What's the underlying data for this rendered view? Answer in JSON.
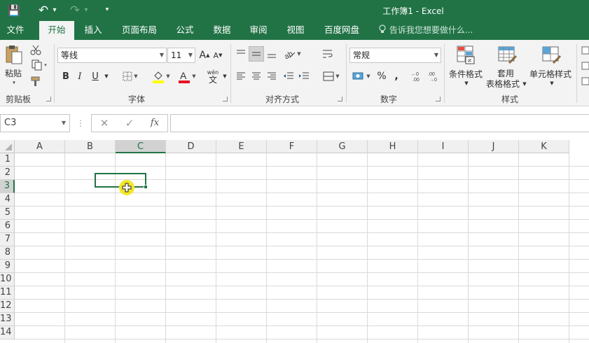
{
  "window": {
    "title": "工作簿1 - Excel"
  },
  "quick_access": {
    "save": "💾",
    "undo": "↶",
    "undo_arrow": "▾",
    "redo": "↷",
    "redo_arrow": "▾",
    "customize": "⯆"
  },
  "tabs": [
    "文件",
    "开始",
    "插入",
    "页面布局",
    "公式",
    "数据",
    "审阅",
    "视图",
    "百度网盘"
  ],
  "tell_me": "告诉我您想要做什么...",
  "ribbon": {
    "clipboard": {
      "paste": "粘贴",
      "group": "剪贴板"
    },
    "font": {
      "name": "等线",
      "size": "11",
      "grow": "A",
      "shrink": "A",
      "bold": "B",
      "italic": "I",
      "underline": "U",
      "wen": "wén",
      "wen_char": "文",
      "group": "字体"
    },
    "alignment": {
      "group": "对齐方式"
    },
    "number": {
      "format": "常规",
      "percent": "%",
      "comma": ",",
      "group": "数字"
    },
    "styles": {
      "conditional": "条件格式",
      "table_1": "套用",
      "table_2": "表格格式",
      "cell": "单元格样式",
      "group": "样式"
    }
  },
  "formula_bar": {
    "name_box": "C3",
    "cancel": "✕",
    "enter": "✓",
    "fx": "fx",
    "formula": ""
  },
  "grid": {
    "columns": [
      "A",
      "B",
      "C",
      "D",
      "E",
      "F",
      "G",
      "H",
      "I",
      "J",
      "K"
    ],
    "rows": [
      "1",
      "2",
      "3",
      "4",
      "5",
      "6",
      "7",
      "8",
      "9",
      "10",
      "11",
      "12",
      "13",
      "14"
    ],
    "selected_column": "C",
    "selected_row": "3"
  },
  "colors": {
    "accent": "#217346",
    "cursor": "#f3e82a",
    "font_color_bar": "#e81123",
    "fill_color_bar": "#ffff00"
  }
}
